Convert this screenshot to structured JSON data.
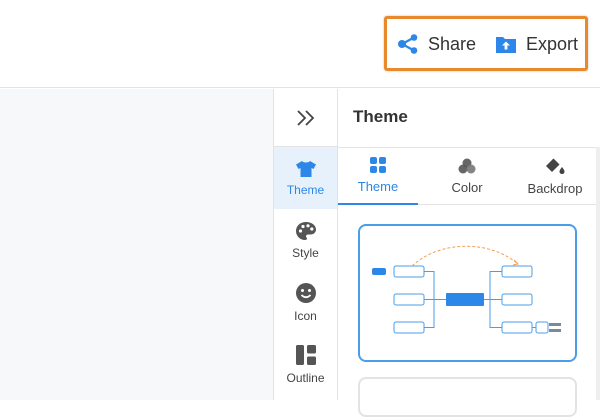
{
  "header": {
    "share_label": "Share",
    "export_label": "Export"
  },
  "rail": {
    "items": [
      {
        "label": "Theme",
        "icon": "tshirt-icon",
        "active": true
      },
      {
        "label": "Style",
        "icon": "palette-icon",
        "active": false
      },
      {
        "label": "Icon",
        "icon": "smiley-icon",
        "active": false
      },
      {
        "label": "Outline",
        "icon": "outline-icon",
        "active": false
      }
    ]
  },
  "panel": {
    "title": "Theme",
    "tabs": [
      {
        "label": "Theme",
        "icon": "grid-icon",
        "active": true
      },
      {
        "label": "Color",
        "icon": "color-circles-icon",
        "active": false
      },
      {
        "label": "Backdrop",
        "icon": "paint-bucket-icon",
        "active": false
      }
    ]
  },
  "colors": {
    "accent": "#2d87e8",
    "highlight": "#e8892c",
    "active_bg": "#e6f1fb",
    "icon_gray": "#555555"
  }
}
